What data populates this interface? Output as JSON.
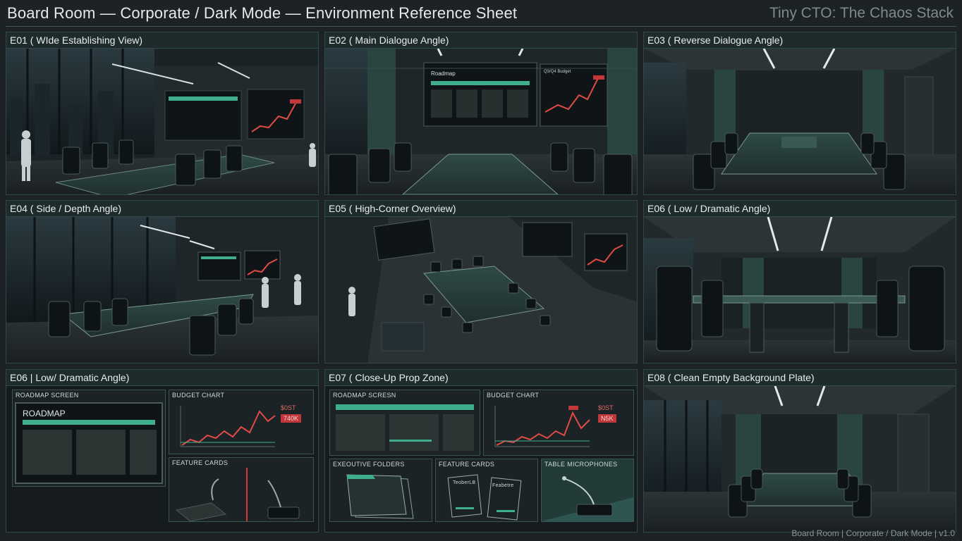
{
  "header": {
    "title": "Board Room — Corporate / Dark Mode — Environment Reference Sheet",
    "brand": "Tiny CTO: The Chaos Stack"
  },
  "footer": "Board Room | Corporate / Dark Mode | v1.0",
  "panels": [
    {
      "title": "E01 ( WIde Establishing View)"
    },
    {
      "title": "E02 ( Main Dialogue Angle)"
    },
    {
      "title": "E03 ( Reverse Dialogue Angle)"
    },
    {
      "title": "E04 ( Side / Depth Angle)"
    },
    {
      "title": "E05 ( High-Corner Overview)"
    },
    {
      "title": "E06 ( Low / Dramatic Angle)"
    },
    {
      "title": "E06 | Low/ Dramatic Angle)"
    },
    {
      "title": "E07 ( Close-Up Prop Zone)"
    },
    {
      "title": "E08 ( Clean Empty Background Plate)"
    }
  ],
  "props_left": {
    "roadmap_label": "ROADMAP SCREEN",
    "roadmap_text": "ROADMAP",
    "budget_label": "BUDGET CHART",
    "cost_label": "$0ST",
    "cost_value": "740K",
    "feature_label": "FEATURE CARDS"
  },
  "props_mid": {
    "roadmap_label": "ROADMAP SCRESN",
    "budget_label": "BUDGET CHART",
    "cost_label": "$0ST",
    "cost_value": "N5K",
    "folders_label": "EXEOUTIVE FOLDERS",
    "feature_label": "FEATURE CARDS",
    "mics_label": "TABLE MICROPHONES",
    "card_text_1": "TeoberLB",
    "card_text_2": "Feabetre"
  },
  "screens": {
    "e02_roadmap": "Roadmap",
    "e02_chart": "Q3/Q4 Budget"
  },
  "colors": {
    "accent": "#3fae8e",
    "alert": "#c2383a",
    "line": "#e04b45",
    "bg": "#1d2226"
  }
}
